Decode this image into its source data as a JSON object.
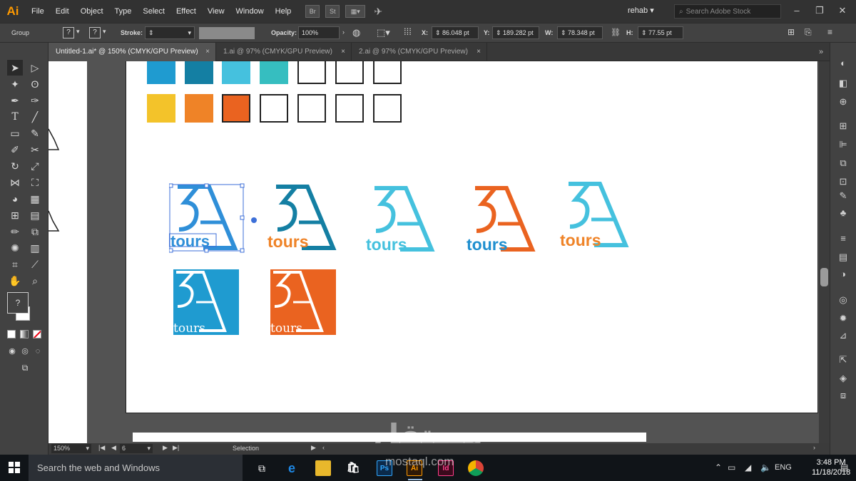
{
  "menubar": {
    "app_logo": "Ai",
    "menus": [
      "File",
      "Edit",
      "Object",
      "Type",
      "Select",
      "Effect",
      "View",
      "Window",
      "Help"
    ],
    "bridge": "Br",
    "stock": "St",
    "workspace": "rehab",
    "search_placeholder": "Search Adobe Stock"
  },
  "control": {
    "selection_type": "Group",
    "stroke_label": "Stroke:",
    "opacity_label": "Opacity:",
    "opacity_value": "100%",
    "x_label": "X:",
    "x_value": "86.048 pt",
    "y_label": "Y:",
    "y_value": "189.282 pt",
    "w_label": "W:",
    "w_value": "78.348 pt",
    "h_label": "H:",
    "h_value": "77.55 pt",
    "fill_placeholder": "?",
    "stroke_placeholder": "?"
  },
  "tabs": [
    {
      "label": "Untitled-1.ai* @ 150% (CMYK/GPU Preview)",
      "active": true
    },
    {
      "label": "1.ai @ 97% (CMYK/GPU Preview)",
      "active": false
    },
    {
      "label": "2.ai @ 97% (CMYK/GPU Preview)",
      "active": false
    }
  ],
  "colors": {
    "blue1": "#1f9bd0",
    "teal_dark": "#147fa3",
    "cyan": "#45c1de",
    "teal": "#36bec0",
    "yellow": "#f3c32a",
    "orange": "#ef8327",
    "orange_dark": "#ea6320",
    "selection_blue": "#3c6fd8"
  },
  "logos": {
    "mark": "3A",
    "word": "tours"
  },
  "status": {
    "zoom": "150%",
    "artboard": "6",
    "tool": "Selection"
  },
  "tool_fill_label": "?",
  "watermark": {
    "arabic": "مستقل",
    "latin": "mostaql.com"
  },
  "taskbar": {
    "search_text": "Search the web and Windows",
    "lang": "ENG",
    "time": "3:48 PM",
    "date": "11/18/2018",
    "apps": [
      "Ps",
      "Ai",
      "Id"
    ]
  }
}
